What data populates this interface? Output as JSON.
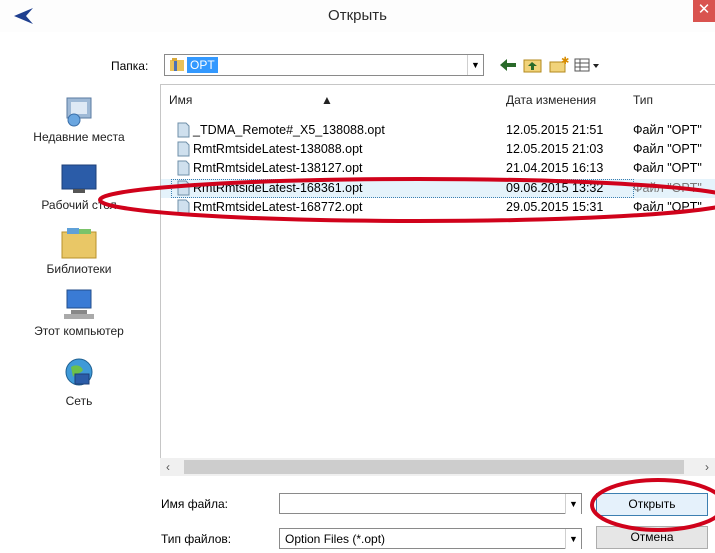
{
  "dialog": {
    "title": "Открыть",
    "close_glyph": "✕"
  },
  "toolbar": {
    "lookin_label": "Папка:",
    "lookin_value": "OPT",
    "icons": [
      "back-icon",
      "up-folder-icon",
      "new-folder-icon",
      "view-menu-icon"
    ]
  },
  "places": [
    {
      "label": "Недавние места",
      "icon": "recent-places-icon"
    },
    {
      "label": "Рабочий стол",
      "icon": "desktop-icon"
    },
    {
      "label": "Библиотеки",
      "icon": "libraries-icon"
    },
    {
      "label": "Этот компьютер",
      "icon": "this-pc-icon"
    },
    {
      "label": "Сеть",
      "icon": "network-icon"
    }
  ],
  "columns": {
    "name": "Имя",
    "date": "Дата изменения",
    "type": "Тип"
  },
  "files": [
    {
      "name": "_TDMA_Remote#_X5_138088.opt",
      "date": "12.05.2015 21:51",
      "type": "Файл \"OPT\""
    },
    {
      "name": "RmtRmtsideLatest-138088.opt",
      "date": "12.05.2015 21:03",
      "type": "Файл \"OPT\""
    },
    {
      "name": "RmtRmtsideLatest-138127.opt",
      "date": "21.04.2015 16:13",
      "type": "Файл \"OPT\""
    },
    {
      "name": "RmtRmtsideLatest-168361.opt",
      "date": "09.06.2015 13:32",
      "type": "Файл \"OPT\""
    },
    {
      "name": "RmtRmtsideLatest-168772.opt",
      "date": "29.05.2015 15:31",
      "type": "Файл \"OPT\""
    }
  ],
  "bottom": {
    "filename_label": "Имя файла:",
    "filename_value": "",
    "filetype_label": "Тип файлов:",
    "filetype_value": "Option Files (*.opt)",
    "open_button": "Открыть",
    "cancel_button": "Отмена"
  },
  "colors": {
    "selection": "#3399ff",
    "annotation": "#d0021b",
    "close": "#d9534f"
  }
}
